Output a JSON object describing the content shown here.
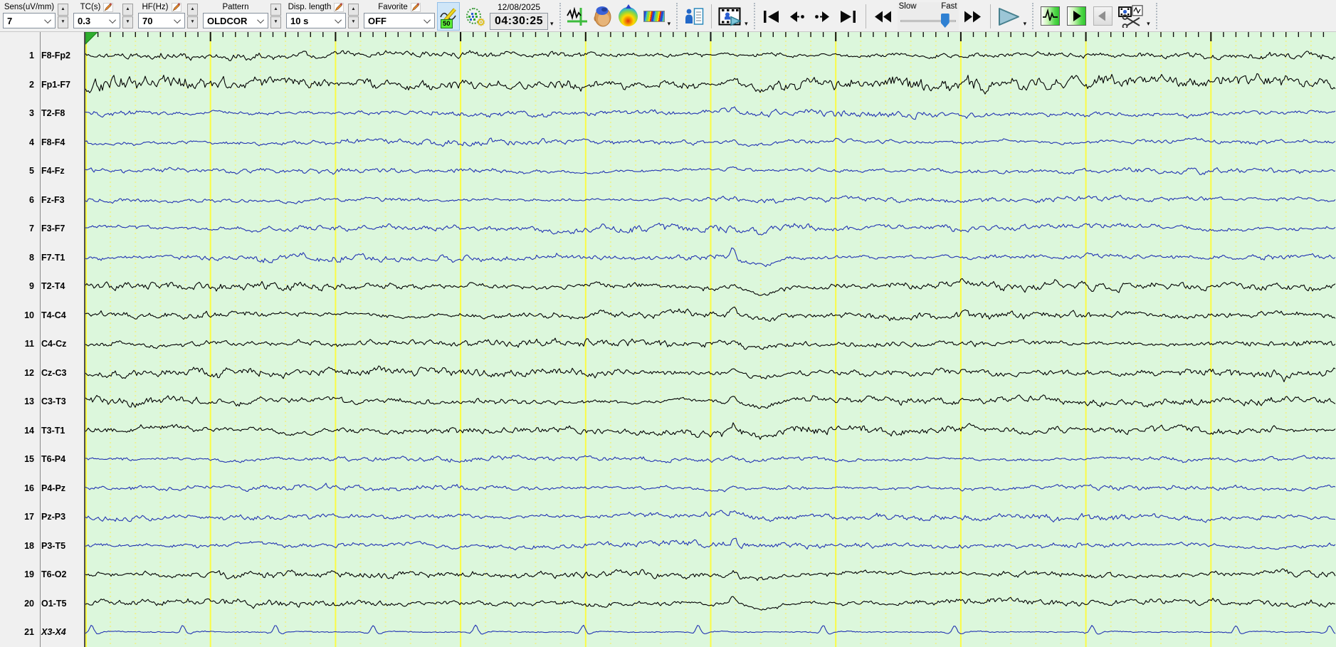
{
  "toolbar": {
    "params": [
      {
        "id": "sens",
        "label": "Sens(uV/mm)",
        "value": "7",
        "pencil": false,
        "spinner": true
      },
      {
        "id": "tc",
        "label": "TC(s)",
        "value": "0.3",
        "pencil": true,
        "spinner": true
      },
      {
        "id": "hf",
        "label": "HF(Hz)",
        "value": "70",
        "pencil": true,
        "spinner": true
      },
      {
        "id": "pattern",
        "label": "Pattern",
        "value": "OLDCOR",
        "pencil": false,
        "spinner": true
      },
      {
        "id": "disp-length",
        "label": "Disp. length",
        "value": "10 s",
        "pencil": true,
        "spinner": true
      },
      {
        "id": "favorite",
        "label": "Favorite",
        "value": "OFF",
        "pencil": true,
        "spinner": false
      }
    ],
    "wave_edit_badge": "50",
    "datetime": {
      "date": "12/08/2025",
      "time": "04:30:25"
    },
    "speed": {
      "slow": "Slow",
      "fast": "Fast",
      "position_pct": 78
    },
    "icon_names": [
      "waveform-edit",
      "montage-settings",
      "datetime-dropdown",
      "waveform-view",
      "head-3d-map",
      "topographic-map",
      "spectrogram",
      "patient-info",
      "video-review",
      "skip-to-start",
      "step-back",
      "step-forward",
      "skip-to-end",
      "rewind",
      "speed-slider",
      "fast-forward",
      "play",
      "waveform-mode-green",
      "play-mode-green",
      "prev-page-disabled",
      "video-clip-scissors"
    ]
  },
  "display": {
    "window_seconds": 10,
    "major_grid_seconds": 1,
    "minor_grid_seconds": 0.2,
    "tick_seconds": 0.1
  },
  "colors": {
    "trace_background": "#dcf7dc",
    "grid_major": "#fbfb45",
    "grid_minor": "#edf296",
    "trace_blue": "#2233b2",
    "trace_black": "#000000",
    "panel_background": "#f0f0f0",
    "selected_button": "#cfe6f8"
  },
  "channels": [
    {
      "num": "1",
      "label": "F8-Fp2",
      "color": "black",
      "amp": 4.5,
      "hf": 2.0,
      "kind": "eeg",
      "spike": 0,
      "italic": false
    },
    {
      "num": "2",
      "label": "Fp1-F7",
      "color": "black",
      "amp": 9.0,
      "hf": 4.5,
      "kind": "eeg",
      "spike": 6,
      "italic": false
    },
    {
      "num": "3",
      "label": "T2-F8",
      "color": "blue",
      "amp": 4.5,
      "hf": 1.8,
      "kind": "eeg",
      "spike": 6,
      "italic": false
    },
    {
      "num": "4",
      "label": "F8-F4",
      "color": "blue",
      "amp": 4.0,
      "hf": 1.6,
      "kind": "eeg",
      "spike": 4,
      "italic": false
    },
    {
      "num": "5",
      "label": "F4-Fz",
      "color": "blue",
      "amp": 3.5,
      "hf": 1.5,
      "kind": "eeg",
      "spike": 3,
      "italic": false
    },
    {
      "num": "6",
      "label": "Fz-F3",
      "color": "blue",
      "amp": 3.5,
      "hf": 1.5,
      "kind": "eeg",
      "spike": 3,
      "italic": false
    },
    {
      "num": "7",
      "label": "F3-F7",
      "color": "blue",
      "amp": 5.0,
      "hf": 2.0,
      "kind": "eeg",
      "spike": 4,
      "italic": false
    },
    {
      "num": "8",
      "label": "F7-T1",
      "color": "blue",
      "amp": 4.5,
      "hf": 1.8,
      "kind": "eeg",
      "spike": 13,
      "italic": false
    },
    {
      "num": "9",
      "label": "T2-T4",
      "color": "black",
      "amp": 5.5,
      "hf": 2.2,
      "kind": "eeg",
      "spike": 9,
      "italic": false
    },
    {
      "num": "10",
      "label": "T4-C4",
      "color": "black",
      "amp": 5.5,
      "hf": 2.2,
      "kind": "eeg",
      "spike": 7,
      "italic": false
    },
    {
      "num": "11",
      "label": "C4-Cz",
      "color": "black",
      "amp": 5.0,
      "hf": 2.0,
      "kind": "eeg",
      "spike": 5,
      "italic": false
    },
    {
      "num": "12",
      "label": "Cz-C3",
      "color": "black",
      "amp": 6.0,
      "hf": 2.2,
      "kind": "eeg",
      "spike": 5,
      "italic": false
    },
    {
      "num": "13",
      "label": "C3-T3",
      "color": "black",
      "amp": 5.5,
      "hf": 2.0,
      "kind": "eeg",
      "spike": 10,
      "italic": false
    },
    {
      "num": "14",
      "label": "T3-T1",
      "color": "black",
      "amp": 6.0,
      "hf": 2.4,
      "kind": "eeg",
      "spike": 12,
      "italic": false
    },
    {
      "num": "15",
      "label": "T6-P4",
      "color": "blue",
      "amp": 3.5,
      "hf": 1.4,
      "kind": "eeg",
      "spike": 3,
      "italic": false
    },
    {
      "num": "16",
      "label": "P4-Pz",
      "color": "blue",
      "amp": 3.5,
      "hf": 1.4,
      "kind": "eeg",
      "spike": 3,
      "italic": false
    },
    {
      "num": "17",
      "label": "Pz-P3",
      "color": "blue",
      "amp": 4.5,
      "hf": 1.8,
      "kind": "eeg",
      "spike": 5,
      "italic": false
    },
    {
      "num": "18",
      "label": "P3-T5",
      "color": "blue",
      "amp": 4.5,
      "hf": 1.8,
      "kind": "eeg",
      "spike": 5,
      "italic": false
    },
    {
      "num": "19",
      "label": "T6-O2",
      "color": "black",
      "amp": 5.0,
      "hf": 2.0,
      "kind": "eeg",
      "spike": 8,
      "italic": false
    },
    {
      "num": "20",
      "label": "O1-T5",
      "color": "black",
      "amp": 4.5,
      "hf": 1.8,
      "kind": "eeg",
      "spike": 8,
      "italic": false
    },
    {
      "num": "21",
      "label": "X3-X4",
      "color": "blue",
      "amp": 1.0,
      "hf": 1.0,
      "kind": "ecg",
      "spike": 0,
      "italic": true
    }
  ]
}
